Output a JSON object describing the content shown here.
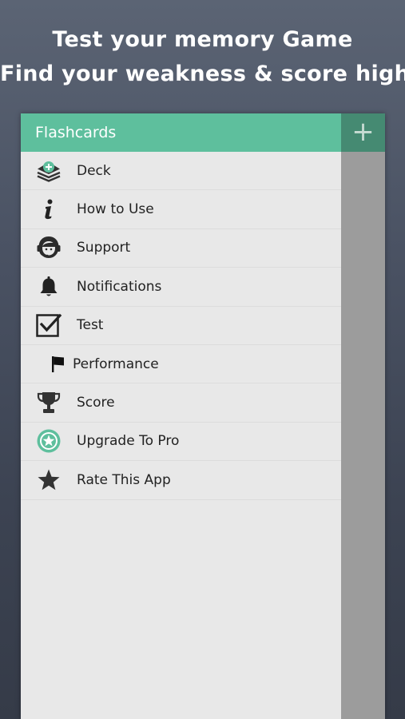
{
  "promo": {
    "line1": "Test your memory Game",
    "line2": "Find your weakness & score high"
  },
  "drawer": {
    "title": "Flashcards",
    "items": [
      {
        "label": "Deck",
        "icon": "deck-add-icon"
      },
      {
        "label": "How to Use",
        "icon": "info-icon"
      },
      {
        "label": "Support",
        "icon": "support-agent-icon"
      },
      {
        "label": "Notifications",
        "icon": "bell-icon"
      },
      {
        "label": "Test",
        "icon": "checkbox-icon"
      },
      {
        "label": "Performance",
        "icon": "flag-icon"
      },
      {
        "label": "Score",
        "icon": "trophy-icon"
      },
      {
        "label": "Upgrade To Pro",
        "icon": "pro-star-badge-icon"
      },
      {
        "label": "Rate This App",
        "icon": "star-icon"
      }
    ]
  },
  "toolbar": {
    "add_icon": "plus-icon",
    "add_glyph": "+"
  },
  "colors": {
    "accent": "#5ebf9d",
    "accent_dark": "#458a72",
    "drawer_bg": "#e8e8e8",
    "overlay": "#9c9c9c"
  }
}
